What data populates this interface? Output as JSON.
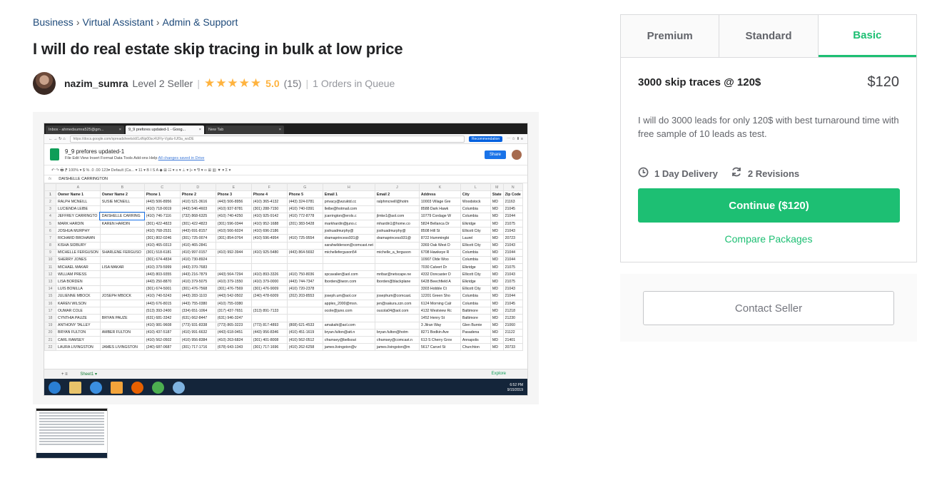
{
  "breadcrumb": {
    "items": [
      "Business",
      "Virtual Assistant",
      "Admin & Support"
    ],
    "separator": "›"
  },
  "gig": {
    "title": "I will do real estate skip tracing in bulk at low price"
  },
  "seller": {
    "name": "nazim_sumra",
    "level": "Level 2 Seller",
    "stars": "★★★★★",
    "rating": "5.0",
    "reviews": "(15)",
    "queue": "1 Orders in Queue"
  },
  "screenshot": {
    "tabs": [
      {
        "label": "Inbox - ahmedsumra525@gm...",
        "close": "×"
      },
      {
        "label": "9_9 prefores updated-1 - Goog...",
        "close": "×"
      },
      {
        "label": "New Tab",
        "close": "×"
      }
    ],
    "url": "https://docs.google.com/spreadsheets/d/1ztNp00sc4UFly-Vgdu-IUf3a_wsDE",
    "recommendation": "Recommendation",
    "doc_title": "9_9 prefores updated-1",
    "menu": "File   Edit   View   Insert   Format   Data   Tools   Add-ons   Help",
    "saved": "All changes saved in Drive",
    "share": "Share",
    "toolbar": "↶  ↷  🖶  ⁋   100% ▾   $  %  .0  .00  123▾   Default (Ca... ▾   11 ▾   B  I  S  A   ◆  ⊞  ☷ ▾   ≡ ▾  ⊥ ▾  |÷ ▾  ⅋ ▾   ∞  ⊞  ▥  ▼ ▾  Σ ▾",
    "fx": "fx",
    "fx_value": "DAISHELLE CARRINGTON",
    "col_letters": [
      "A",
      "B",
      "C",
      "D",
      "E",
      "F",
      "G",
      "H",
      "J",
      "K",
      "L",
      "M",
      "N",
      "O"
    ],
    "headers": [
      "Owner Name 1",
      "Owner Name 2",
      "Phone 1",
      "Phone 2",
      "Phone 3",
      "Phone 4",
      "Phone 5",
      "Email 1",
      "Email 2",
      "Address",
      "City",
      "State",
      "Zip Code"
    ],
    "rows": [
      [
        "2",
        "RALPH MCNEILL",
        "SUSIE MCNEILL",
        "(443) 506-8956",
        "(410) 521-3616",
        "(443) 506-8956",
        "(410) 365-4132",
        "(443) 324-0781",
        "privacy@wzuktd.cc",
        "ralphmcneill@hotm",
        "10003 Village Gre",
        "Woodstock",
        "MD",
        "21163"
      ],
      [
        "3",
        "LUCIENDA LEIBE",
        "",
        "(410) 718-0019",
        "(443) 546-4603",
        "(410) 937-8781",
        "(301) 288-7150",
        "(410) 740-0391",
        "lleibe@hotmail.com",
        "",
        "8588 Dark Hawk",
        "Columbia",
        "MD",
        "21045"
      ],
      [
        "4",
        "JEFFREY CARRINGTO",
        "DAISHELLE CARRING",
        "(410) 746-7116",
        "(732) 868-6325",
        "(410) 740-4250",
        "(410) 925-9142",
        "(410) 772-8778",
        "jcarrington@erols.c",
        "jlmke1@aol.com",
        "10779 Cordage W",
        "Columbia",
        "MD",
        "21044"
      ],
      [
        "5",
        "MARK HARDIN",
        "KAREN HARDIN",
        "(301) 422-4823",
        "(301) 422-4823",
        "(301) 596-0344",
        "(410) 952-1688",
        "(201) 383-5428",
        "markhardin@juno.c",
        "mhardin1@home.co",
        "5824 Bellanca Dr",
        "Elkridge",
        "MD",
        "21075"
      ],
      [
        "6",
        "JOSHUA MURPHY",
        "",
        "(410) 768-2531",
        "(443) 691-8157",
        "(410) 566-6024",
        "(410) 696-2186",
        "",
        "joshuadmurphy@",
        "joshuadmurphy@",
        "8508 Hill St",
        "Ellicott City",
        "MD",
        "21043"
      ],
      [
        "7",
        "RICHARD BROHAWN",
        "",
        "(301) 802-0246",
        "(301) 725-0074",
        "(301) 854-0764",
        "(410) 596-4954",
        "(410) 725-9554",
        "dramaprincess931@",
        "dramaprincess931@",
        "8722 Hummingbi",
        "Laurel",
        "MD",
        "20723"
      ],
      [
        "8",
        "KISHA SIDBURY",
        "",
        "(410) 465-0313",
        "(410) 465-2841",
        "",
        "",
        "",
        "sarahwilderson@comcast.net",
        "",
        "3369 Oak West D",
        "Ellicott City",
        "MD",
        "21043"
      ],
      [
        "9",
        "MICHELLE FERGUSON",
        "SHARLENE FERGUSO",
        "(301) 518-6181",
        "(410) 997-0157",
        "(410) 992-3944",
        "(410) 925-5480",
        "(443) 864-5692",
        "michelleferguson54",
        "michelle_a_ferguson",
        "6708 Hawkeye R",
        "Columbia",
        "MD",
        "21044"
      ],
      [
        "10",
        "SHERRY JONES",
        "",
        "(301) 674-4834",
        "(410) 730-8924",
        "",
        "",
        "",
        "",
        "",
        "10907 Olde Woo",
        "Columbia",
        "MD",
        "21044"
      ],
      [
        "11",
        "MICHAEL MAKAR",
        "LISA MAKAR",
        "(410) 379-5999",
        "(443) 370-7683",
        "",
        "",
        "",
        "",
        "",
        "7030 Calvert Dr",
        "Elkridge",
        "MD",
        "21075"
      ],
      [
        "12",
        "WILLIAM PRESS",
        "",
        "(443) 803-9355",
        "(443) 216-7879",
        "(443) 564-7294",
        "(410) 893-3326",
        "(410) 750-8036",
        "spcavalier@aol.com",
        "mribar@netscape.ne",
        "4332 Doncaster D",
        "Ellicott City",
        "MD",
        "21043"
      ],
      [
        "13",
        "LISA BORDEN",
        "",
        "(443) 250-8870",
        "(410) 379-5075",
        "(410) 379-1550",
        "(410) 379-0000",
        "(443) 744-7347",
        "lborden@iwon.com",
        "lborden@blackplane",
        "6428 Beechfield A",
        "Elkridge",
        "MD",
        "21075"
      ],
      [
        "14",
        "LUIS BONILLA",
        "",
        "(301) 674-5001",
        "(301) 476-7568",
        "(301) 476-7569",
        "(301) 476-9009",
        "(410) 720-2378",
        "",
        "",
        "3303 Hobble Ct",
        "Ellicott City",
        "MD",
        "21043"
      ],
      [
        "15",
        "JULIENNE MBOCK",
        "JOSEPH MBOCK",
        "(410) 740-5243",
        "(443) 283-1103",
        "(443) 542-0502",
        "(240) 478-6009",
        "(202) 203-8553",
        "joseph.um@aol.cor",
        "josephum@comcast.",
        "12201 Green Sho",
        "Columbia",
        "MD",
        "21044"
      ],
      [
        "16",
        "KAREN WILSON",
        "",
        "(443) 676-8015",
        "(443) 755-0380",
        "(410) 755-0380",
        "",
        "",
        "apples_2000@msn.",
        "jen@sakura.zzn.com",
        "6124 Morning Calr",
        "Columbia",
        "MD",
        "21045"
      ],
      [
        "17",
        "OUMAR COLE",
        "",
        "(513) 393-2400",
        "(334) 651-1064",
        "(317) 437-7651",
        "(313) 891-7133",
        "",
        "ocole@juno.com",
        "oucola04@aol.com",
        "4132 Westview Rc",
        "Baltimore",
        "MD",
        "21218"
      ],
      [
        "18",
        "CYNTHIA PAUZE",
        "BRYAN PAUZE",
        "(631) 681-3342",
        "(631) 662-8447",
        "(631) 946-3247",
        "",
        "",
        "",
        "",
        "1452 Henry St",
        "Baltimore",
        "MD",
        "21230"
      ],
      [
        "19",
        "ANTHONY TALLEY",
        "",
        "(410) 981-9608",
        "(773) 931-8338",
        "(773) 865-3223",
        "(773) 817-4893",
        "(808) 621-4533",
        "amakahi@aol.com",
        "",
        "3 Jilran Way",
        "Glen Burnie",
        "MD",
        "21060"
      ],
      [
        "20",
        "BRYAN FULTON",
        "AMBER FULTON",
        "(410) 437-5187",
        "(410) 991-6632",
        "(443) 618-0451",
        "(443) 956-8346",
        "(410) 451-1619",
        "bryan.fulton@att.n",
        "bryan.fulton@hotm",
        "8271 Bodkin Ave",
        "Pasadena",
        "MD",
        "21122"
      ],
      [
        "21",
        "CARL RAMSEY",
        "",
        "(410) 562-0502",
        "(410) 956-8384",
        "(410) 263-6824",
        "(301) 401-8008",
        "(410) 562-0512",
        "cframsey@bellsout",
        "cframsey@comcast.n",
        "613 S Cherry Grov",
        "Annapolis",
        "MD",
        "21401"
      ],
      [
        "22",
        "LAURA LIVINGSTON",
        "JAMES LIVINGSTON",
        "(240) 687-0687",
        "(301) 717-1716",
        "(678) 643-1343",
        "(301) 717-1696",
        "(410) 262-6258",
        "james.livingston@v",
        "james.livingston@m",
        "5617 Carvel St",
        "Churchton",
        "MD",
        "20733"
      ]
    ],
    "sheet_tab": "Sheet1 ▾",
    "sheet_ctrls": "+   ≡",
    "explore": "Explore",
    "clock_time": "6:52 PM",
    "clock_date": "9/15/2019"
  },
  "packages": {
    "tabs": [
      {
        "label": "Premium",
        "active": false
      },
      {
        "label": "Standard",
        "active": false
      },
      {
        "label": "Basic",
        "active": true
      }
    ],
    "name": "3000 skip traces @ 120$",
    "price": "$120",
    "description": "I will do 3000 leads for only 120$ with best turnaround time with free sample of 10 leads as test.",
    "delivery": "1 Day Delivery",
    "revisions": "2 Revisions",
    "cta": "Continue ($120)",
    "compare": "Compare Packages"
  },
  "contact": {
    "label": "Contact Seller"
  },
  "colors": {
    "accent": "#1dbf73",
    "star": "#ffb33e",
    "breadcrumb": "#1e4a7a"
  }
}
